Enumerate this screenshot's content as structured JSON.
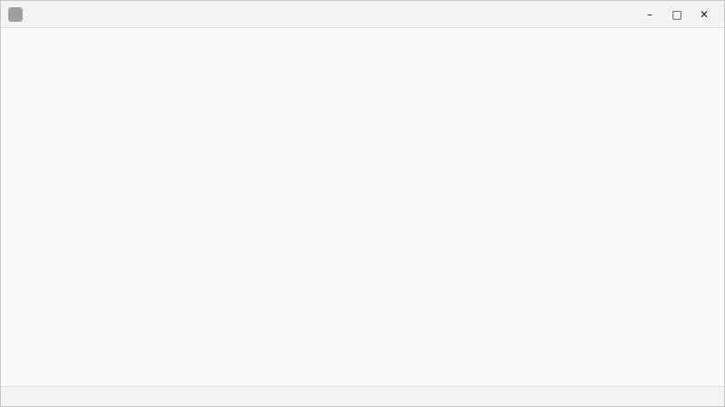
{
  "window": {
    "title": "",
    "controls": {
      "minimize_glyph": "–",
      "maximize_glyph": "□",
      "close_glyph": "✕"
    }
  },
  "content": {
    "notice": ""
  },
  "status_bar": {
    "text": ""
  }
}
